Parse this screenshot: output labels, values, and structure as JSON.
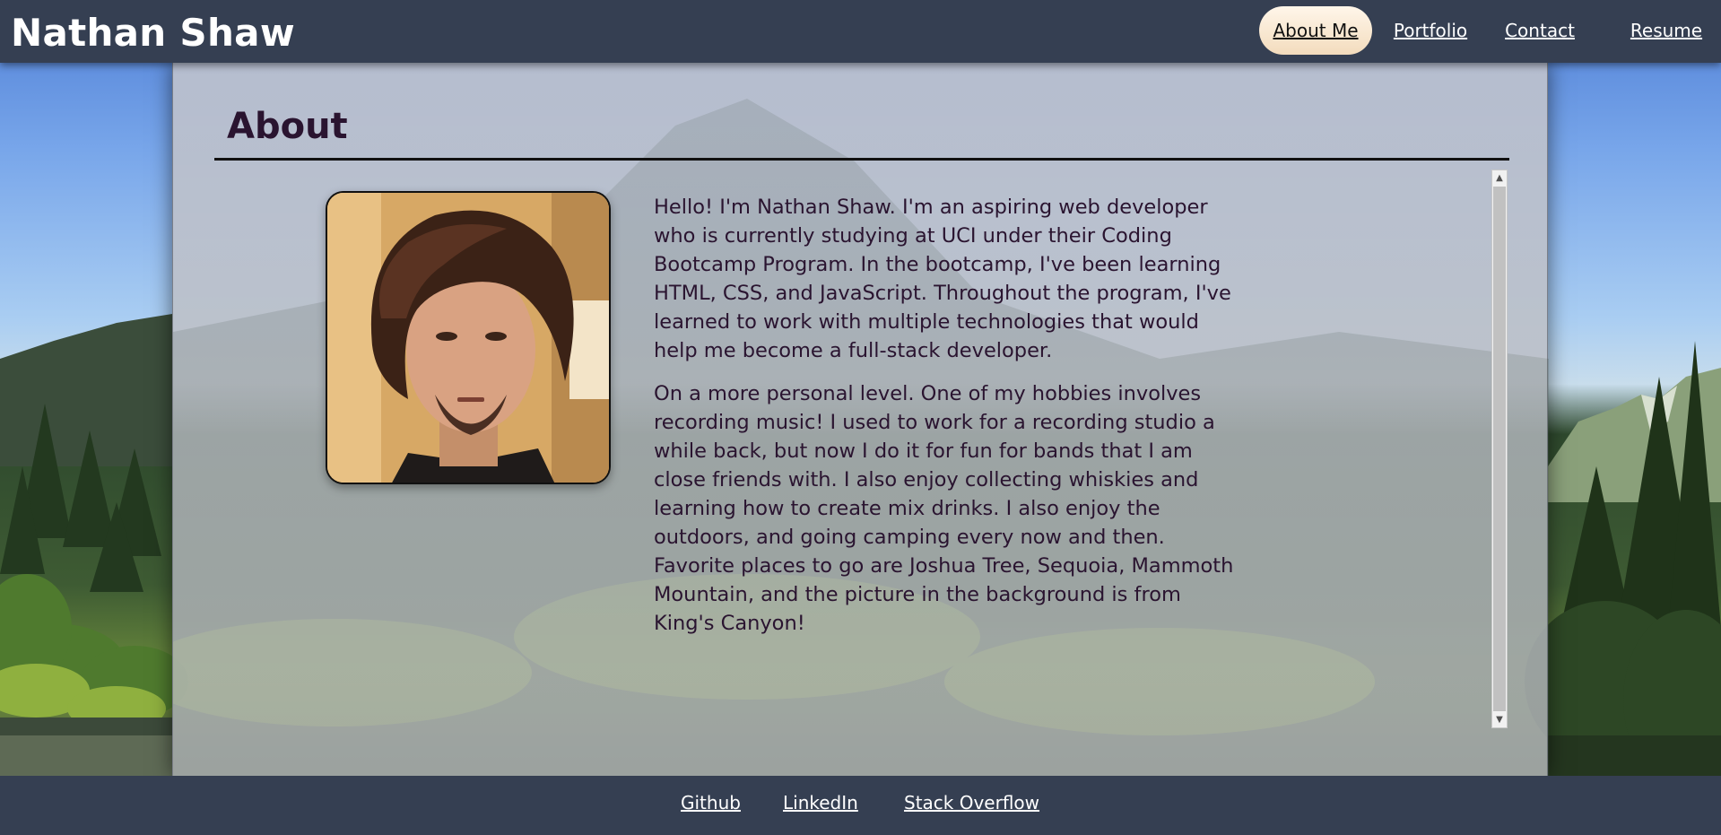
{
  "header": {
    "brand": "Nathan Shaw",
    "nav": [
      {
        "label": "About Me",
        "active": true
      },
      {
        "label": "Portfolio",
        "active": false
      },
      {
        "label": "Contact",
        "active": false
      },
      {
        "label": "Resume",
        "active": false
      }
    ]
  },
  "about": {
    "title": "About",
    "paragraphs": [
      "Hello! I'm Nathan Shaw. I'm an aspiring web developer who is currently studying at UCI under their Coding Bootcamp Program. In the bootcamp, I've been learning HTML, CSS, and JavaScript. Throughout the program, I've learned to work with multiple technologies that would help me become a full-stack developer.",
      "On a more personal level. One of my hobbies involves recording music! I used to work for a recording studio a while back, but now I do it for fun for bands that I am close friends with. I also enjoy collecting whiskies and learning how to create mix drinks. I also enjoy the outdoors, and going camping every now and then. Favorite places to go are Joshua Tree, Sequoia, Mammoth Mountain, and the picture in the background is from King's Canyon!"
    ]
  },
  "footer": {
    "links": [
      "Github",
      "LinkedIn",
      "Stack Overflow"
    ]
  },
  "colors": {
    "header_bg": "#353f52",
    "active_nav": "#f3dcbd",
    "title_text": "#2a1430"
  }
}
